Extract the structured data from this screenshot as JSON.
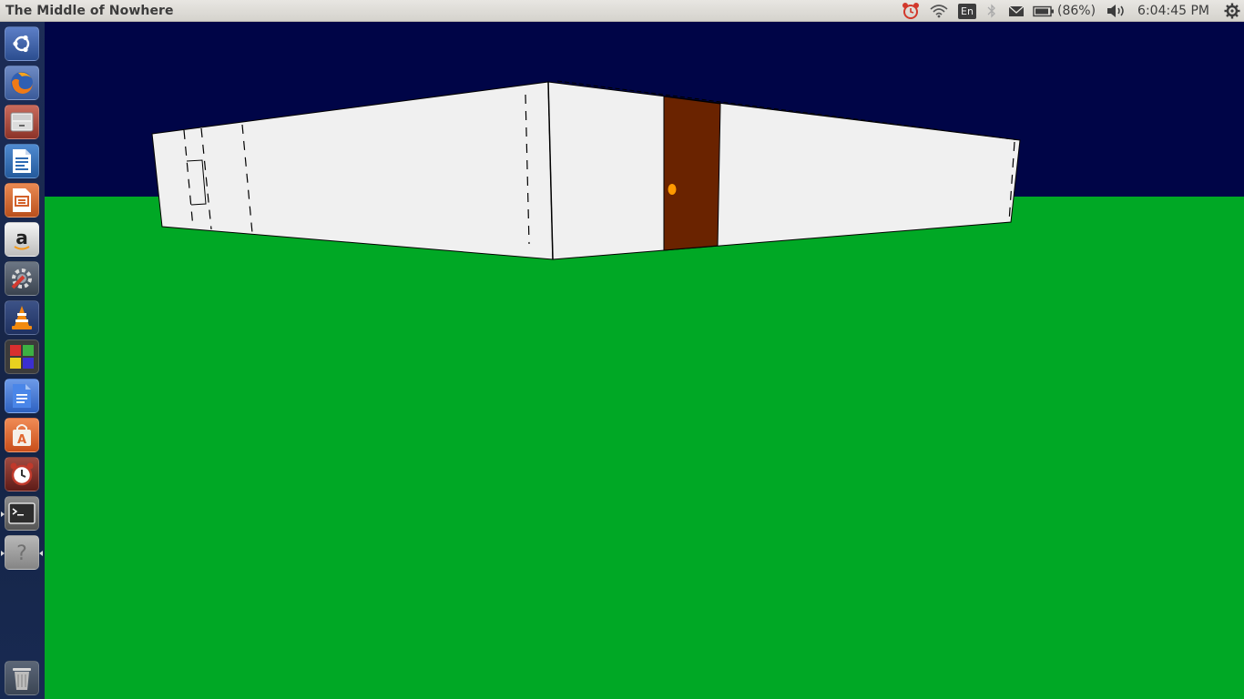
{
  "window": {
    "title": "The Middle of Nowhere"
  },
  "indicators": {
    "keyboard_layout": "En",
    "battery_text": "(86%)",
    "clock": "6:04:45 PM",
    "icons": [
      "alarm-clock-icon",
      "wifi-icon",
      "keyboard-layout-icon",
      "bluetooth-icon",
      "mail-icon",
      "battery-icon",
      "volume-icon",
      "settings-gear-icon"
    ]
  },
  "launcher": {
    "items": [
      {
        "name": "dash-home",
        "icon": "ubuntu-logo-icon",
        "bg": "#2b4d8f"
      },
      {
        "name": "firefox",
        "icon": "firefox-icon",
        "bg": "#3a5a99"
      },
      {
        "name": "file-manager",
        "icon": "filing-cabinet-icon",
        "bg": "#b04a3a"
      },
      {
        "name": "libreoffice-writer",
        "icon": "writer-document-icon",
        "bg": "#2f6bb3"
      },
      {
        "name": "libreoffice-impress",
        "icon": "impress-presentation-icon",
        "bg": "#d3612a"
      },
      {
        "name": "amazon",
        "icon": "amazon-icon",
        "bg": "#cfcfcf"
      },
      {
        "name": "system-settings",
        "icon": "settings-wrench-icon",
        "bg": "#4a5562"
      },
      {
        "name": "vlc",
        "icon": "vlc-cone-icon",
        "bg": "#2b3f6e"
      },
      {
        "name": "colored-squares-app",
        "icon": "colored-squares-icon",
        "bg": "#3b3b3b"
      },
      {
        "name": "google-docs",
        "icon": "docs-icon",
        "bg": "#3f74d6"
      },
      {
        "name": "software-center",
        "icon": "shopping-bag-icon",
        "bg": "#e0662e"
      },
      {
        "name": "alarm-clock",
        "icon": "alarm-clock-icon",
        "bg": "#7a2a2a"
      },
      {
        "name": "terminal",
        "icon": "terminal-icon",
        "bg": "#6b6b6b"
      },
      {
        "name": "unknown-app",
        "icon": "question-mark-icon",
        "bg": "#9a9a9a"
      },
      {
        "name": "trash",
        "icon": "trash-icon",
        "bg": "#5e6a7a"
      }
    ]
  },
  "scene": {
    "sky_color": "#000547",
    "ground_color": "#00a825",
    "wall_color": "#f0f0f0",
    "door_color": "#6a2300",
    "door_knob_color": "#ff9a00"
  }
}
